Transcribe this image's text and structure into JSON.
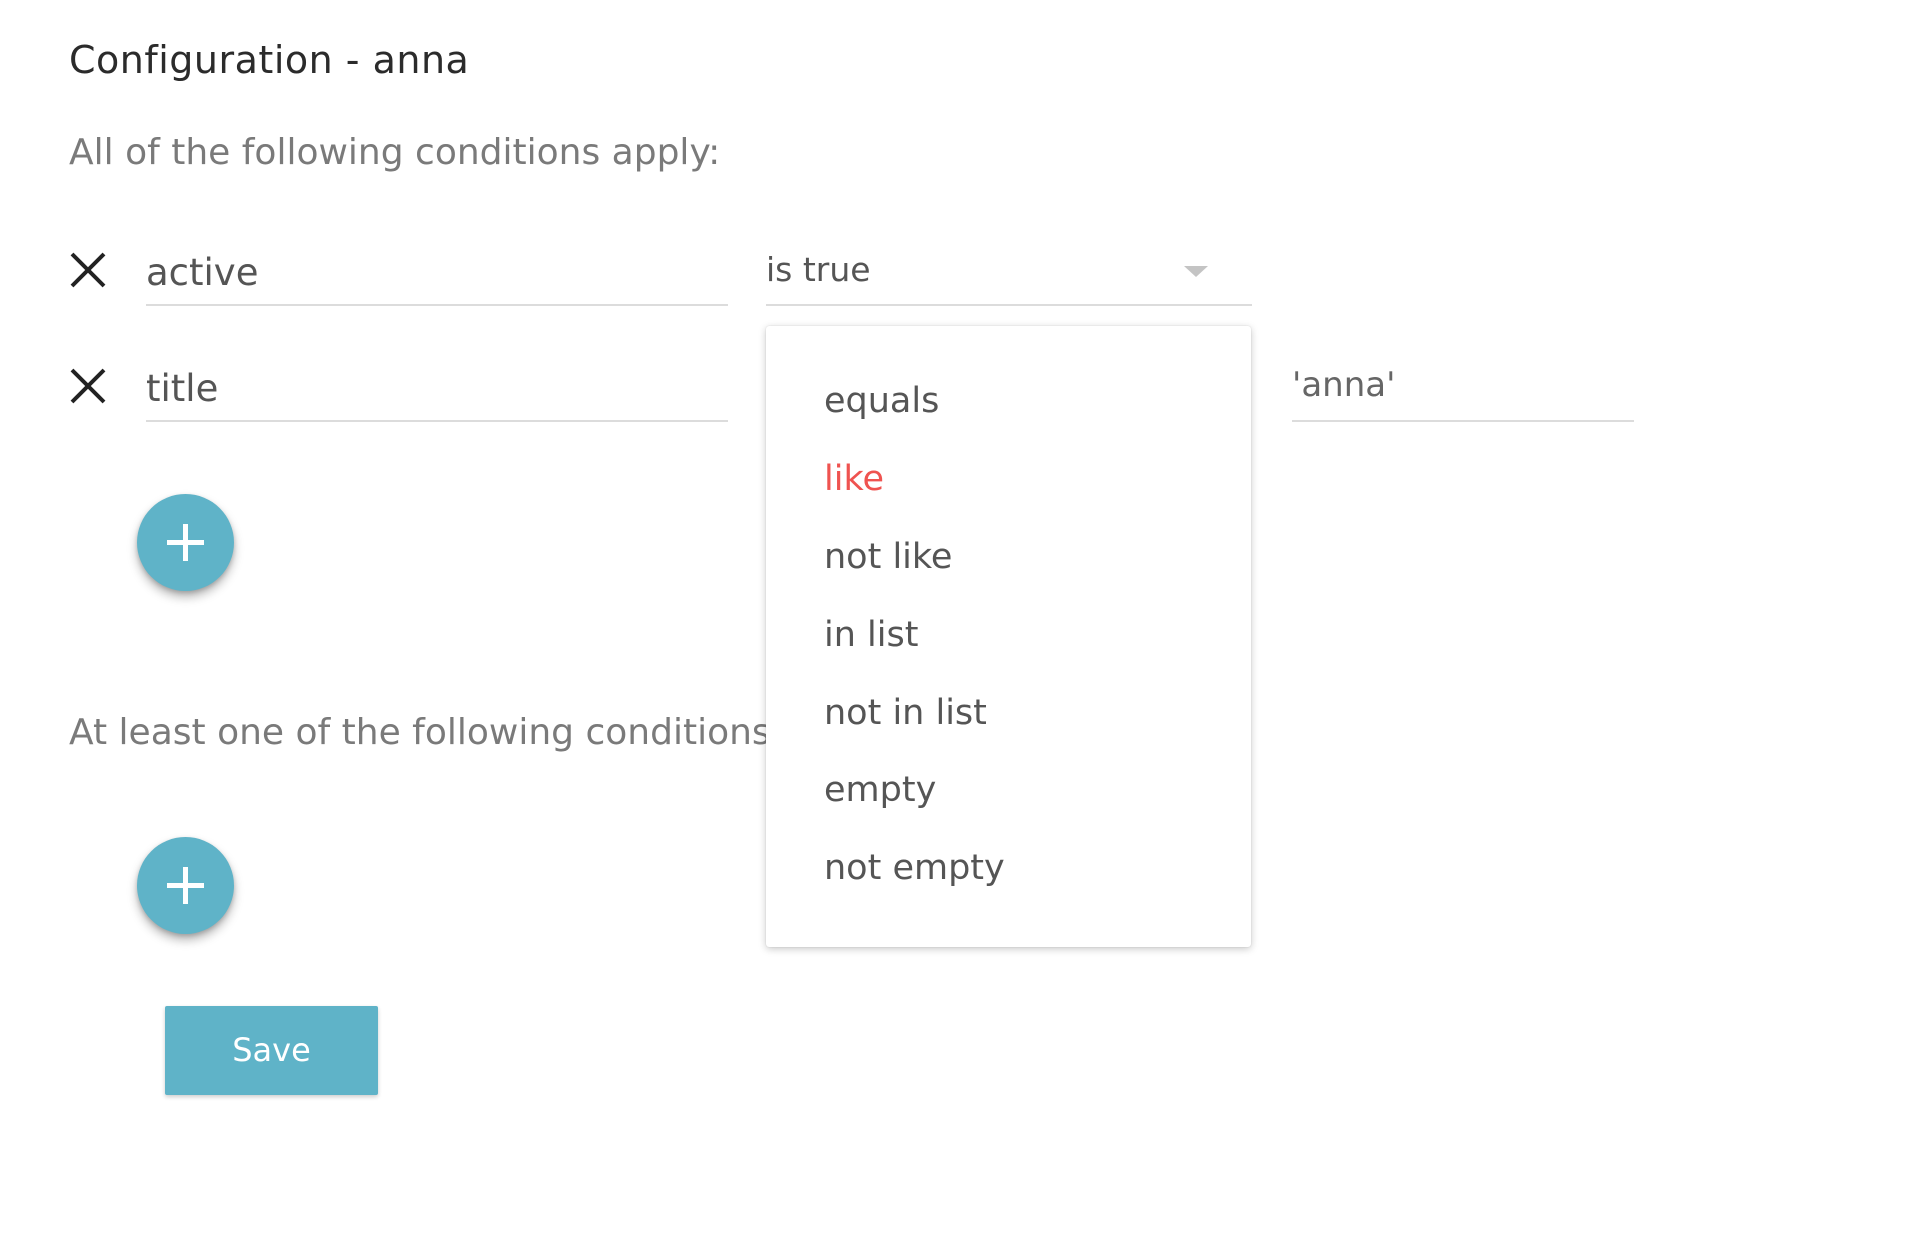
{
  "page": {
    "title": "Configuration - anna"
  },
  "all_conditions": {
    "heading": "All of the following conditions apply:",
    "rows": [
      {
        "field": "active",
        "operator": "is true",
        "value": ""
      },
      {
        "field": "title",
        "operator": "like",
        "value": "'anna'"
      }
    ]
  },
  "any_conditions": {
    "heading": "At least one of the following conditions"
  },
  "operator_menu": {
    "options": [
      "equals",
      "like",
      "not like",
      "in list",
      "not in list",
      "empty",
      "not empty"
    ],
    "highlighted": "like"
  },
  "actions": {
    "save_label": "Save"
  },
  "icons": {
    "remove": "close-icon",
    "add": "plus-icon",
    "dropdown": "caret-down-icon"
  },
  "colors": {
    "accent": "#5fb3c8",
    "highlight": "#ef5350"
  }
}
